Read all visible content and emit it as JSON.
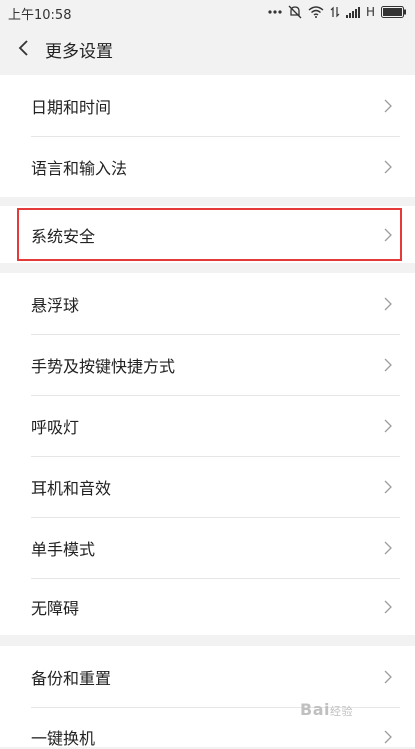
{
  "status_bar": {
    "time": "上午10:58",
    "network": "H"
  },
  "header": {
    "title": "更多设置"
  },
  "groups": [
    {
      "items": [
        {
          "label": "日期和时间"
        },
        {
          "label": "语言和输入法"
        }
      ]
    },
    {
      "items": [
        {
          "label": "系统安全"
        }
      ]
    },
    {
      "items": [
        {
          "label": "悬浮球"
        },
        {
          "label": "手势及按键快捷方式"
        },
        {
          "label": "呼吸灯"
        },
        {
          "label": "耳机和音效"
        },
        {
          "label": "单手模式"
        },
        {
          "label": "无障碍"
        }
      ]
    },
    {
      "items": [
        {
          "label": "备份和重置"
        },
        {
          "label": "一键换机"
        }
      ]
    }
  ],
  "watermark": {
    "brand": "Bai",
    "suffix": "经验"
  },
  "colors": {
    "highlight": "#e53a3a",
    "chevron": "#9e9e9e"
  }
}
